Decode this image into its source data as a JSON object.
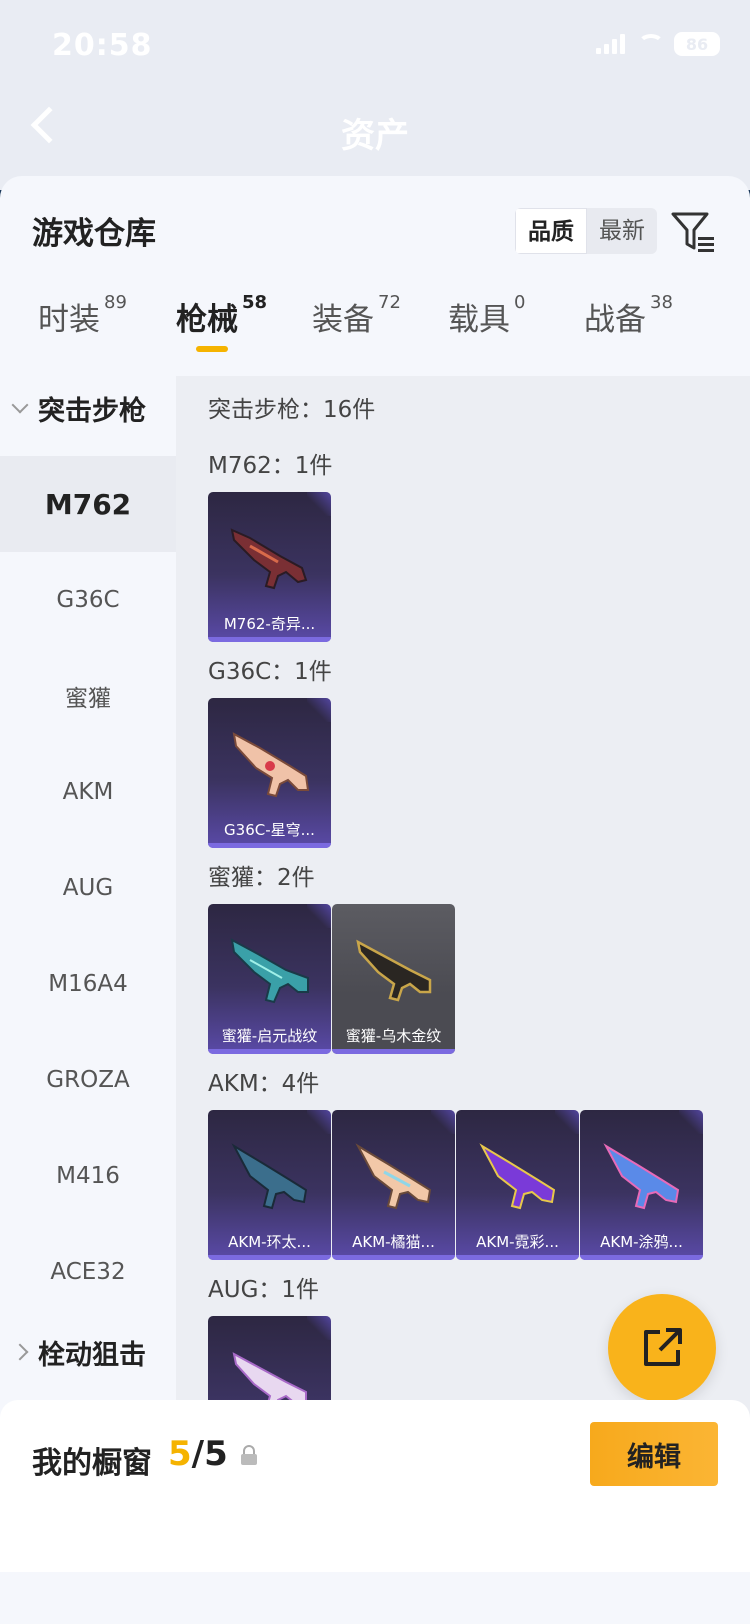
{
  "status_bar": {
    "time": "20:58",
    "battery": "86"
  },
  "nav": {
    "title": "资产"
  },
  "sheet": {
    "title": "游戏仓库",
    "sort": {
      "quality": "品质",
      "latest": "最新"
    }
  },
  "tabs": [
    {
      "label": "时装",
      "count": "89"
    },
    {
      "label": "枪械",
      "count": "58"
    },
    {
      "label": "装备",
      "count": "72"
    },
    {
      "label": "载具",
      "count": "0"
    },
    {
      "label": "战备",
      "count": "38"
    }
  ],
  "categories": {
    "assault": "突击步枪",
    "items": [
      "M762",
      "G36C",
      "蜜獾",
      "AKM",
      "AUG",
      "M16A4",
      "GROZA",
      "M416",
      "ACE32"
    ],
    "sniper": "栓动狙击"
  },
  "content": {
    "total": "突击步枪：16件",
    "sections": [
      {
        "label": "M762：1件",
        "cards": [
          "M762-奇异..."
        ]
      },
      {
        "label": "G36C：1件",
        "cards": [
          "G36C-星穹..."
        ]
      },
      {
        "label": "蜜獾：2件",
        "cards": [
          "蜜獾-启元战纹",
          "蜜獾-乌木金纹"
        ]
      },
      {
        "label": "AKM：4件",
        "cards": [
          "AKM-环太...",
          "AKM-橘猫...",
          "AKM-霓彩...",
          "AKM-涂鸦..."
        ]
      },
      {
        "label": "AUG：1件",
        "cards": [
          ""
        ]
      }
    ]
  },
  "bottom": {
    "title": "我的橱窗",
    "count_current": "5",
    "count_total": "/5",
    "edit": "编辑"
  },
  "colors": {
    "accent": "#f5b300",
    "card_purple": "#5a4aa8"
  }
}
